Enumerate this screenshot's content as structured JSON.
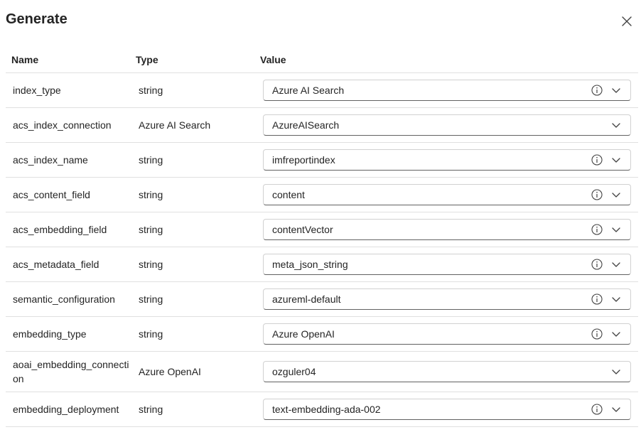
{
  "dialog": {
    "title": "Generate",
    "close_icon": "close-icon"
  },
  "table": {
    "headers": {
      "name": "Name",
      "type": "Type",
      "value": "Value"
    },
    "rows": [
      {
        "name": "index_type",
        "type": "string",
        "value": "Azure AI Search",
        "info": true
      },
      {
        "name": "acs_index_connection",
        "type": "Azure AI Search",
        "value": "AzureAISearch",
        "info": false
      },
      {
        "name": "acs_index_name",
        "type": "string",
        "value": "imfreportindex",
        "info": true
      },
      {
        "name": "acs_content_field",
        "type": "string",
        "value": "content",
        "info": true
      },
      {
        "name": "acs_embedding_field",
        "type": "string",
        "value": "contentVector",
        "info": true
      },
      {
        "name": "acs_metadata_field",
        "type": "string",
        "value": "meta_json_string",
        "info": true
      },
      {
        "name": "semantic_configuration",
        "type": "string",
        "value": "azureml-default",
        "info": true
      },
      {
        "name": "embedding_type",
        "type": "string",
        "value": "Azure OpenAI",
        "info": true
      },
      {
        "name": "aoai_embedding_connection",
        "type": "Azure OpenAI",
        "value": "ozguler04",
        "info": false
      },
      {
        "name": "embedding_deployment",
        "type": "string",
        "value": "text-embedding-ada-002",
        "info": true
      }
    ]
  },
  "icons": {
    "info": "info-icon",
    "dropdown": "chevron-down-icon"
  }
}
